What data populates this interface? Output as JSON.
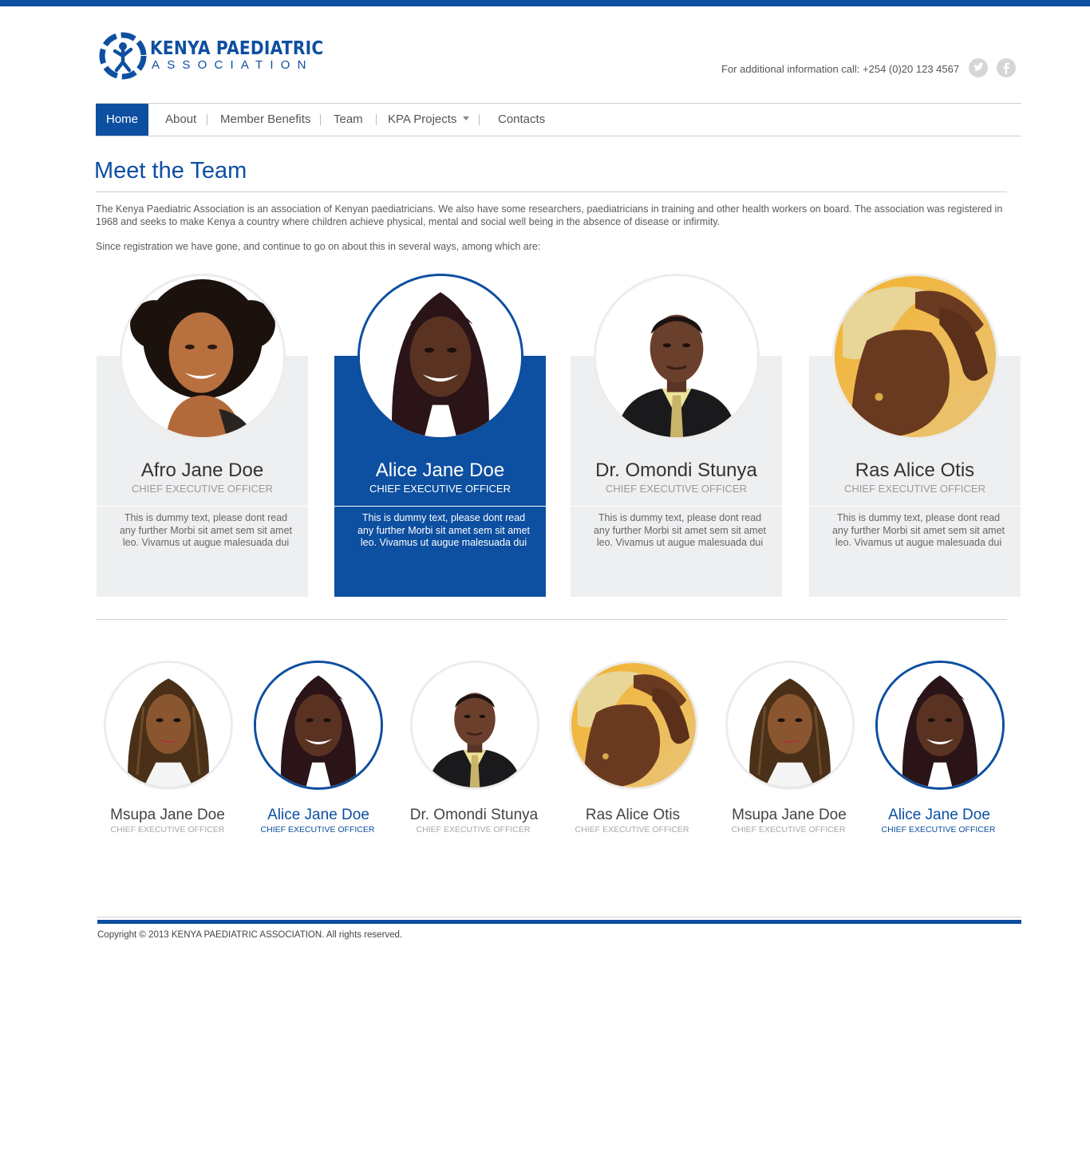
{
  "header": {
    "logo_title": "KENYA PAEDIATRIC",
    "logo_subtitle": "ASSOCIATION",
    "contact": "For additional information call: +254 (0)20 123 4567",
    "social": [
      "twitter-icon",
      "facebook-icon"
    ]
  },
  "nav": {
    "items": [
      "Home",
      "About",
      "Member Benefits",
      "Team",
      "KPA Projects",
      "Contacts"
    ],
    "active": "Home"
  },
  "page": {
    "title": "Meet the Team",
    "intro": "The Kenya Paediatric Association is an association of Kenyan paediatricians. We also have some researchers, paediatricians in training and other health workers on board. The association was registered in 1968 and seeks to make Kenya a country where children achieve physical, mental and social well being in the absence of disease or infirmity.",
    "intro2": "Since registration we have gone, and continue to go on about this in several ways, among which are:"
  },
  "featured": [
    {
      "name": "Afro Jane Doe",
      "role": "CHIEF EXECUTIVE OFFICER",
      "text": "This is dummy text, please dont read any further Morbi sit amet sem sit amet leo. Vivamus ut augue malesuada dui"
    },
    {
      "name": "Alice Jane Doe",
      "role": "CHIEF EXECUTIVE OFFICER",
      "text": "This is dummy text, please dont read any further Morbi sit amet sem sit amet leo. Vivamus ut augue malesuada dui"
    },
    {
      "name": "Dr. Omondi Stunya",
      "role": "CHIEF EXECUTIVE OFFICER",
      "text": "This is dummy text, please dont read any further Morbi sit amet sem sit amet leo. Vivamus ut augue malesuada dui"
    },
    {
      "name": "Ras Alice Otis",
      "role": "CHIEF EXECUTIVE OFFICER",
      "text": "This is dummy text, please dont read any further Morbi sit amet sem sit amet leo. Vivamus ut augue malesuada dui"
    }
  ],
  "members": [
    {
      "name": "Msupa Jane Doe",
      "role": "CHIEF EXECUTIVE OFFICER"
    },
    {
      "name": "Alice Jane Doe",
      "role": "CHIEF EXECUTIVE OFFICER"
    },
    {
      "name": "Dr. Omondi Stunya",
      "role": "CHIEF EXECUTIVE OFFICER"
    },
    {
      "name": "Ras Alice Otis",
      "role": "CHIEF EXECUTIVE OFFICER"
    },
    {
      "name": "Msupa Jane Doe",
      "role": "CHIEF EXECUTIVE OFFICER"
    },
    {
      "name": "Alice Jane Doe",
      "role": "CHIEF EXECUTIVE OFFICER"
    }
  ],
  "footer": {
    "copyright": "Copyright © 2013 KENYA PAEDIATRIC ASSOCIATION. All rights reserved."
  },
  "colors": {
    "brand": "#0d4fa0",
    "card_bg": "#eeeff1"
  }
}
